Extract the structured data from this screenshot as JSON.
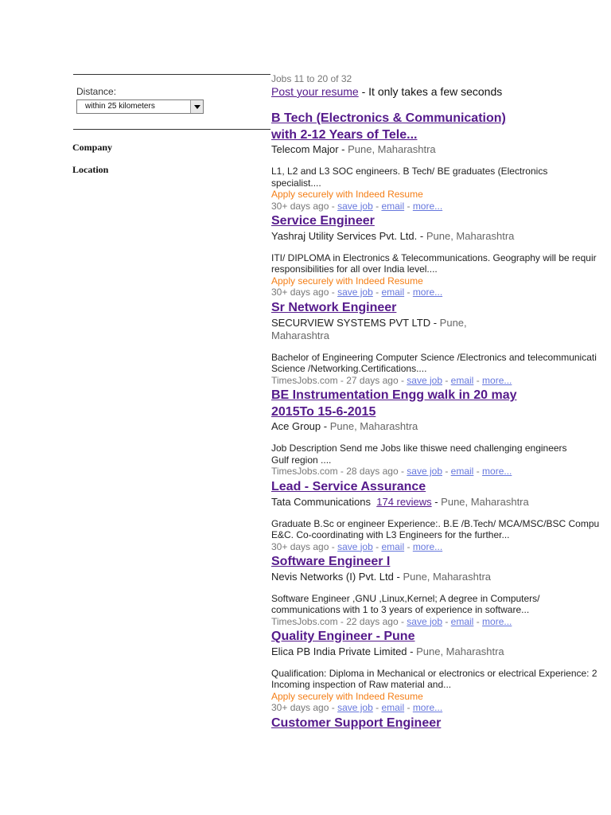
{
  "filters": {
    "distance_label": "Distance:",
    "distance_value": "within 25 kilometers",
    "company_label": "Company",
    "location_label": "Location"
  },
  "results": {
    "count_text": "Jobs 11 to 20 of 32",
    "post_resume_link": "Post your resume",
    "post_resume_suffix": " - It only takes a few seconds"
  },
  "separator": " - ",
  "jobs": [
    {
      "title_line1": "B Tech (Electronics & Communication)",
      "title_line2": "with 2-12 Years of Tele...",
      "company": "Telecom Major",
      "location": "Pune, Maharashtra",
      "snippet_line1": "L1, L2 and L3 SOC engineers. B Tech/ BE graduates (Electronics",
      "snippet_line2": "specialist....",
      "apply": "Apply securely with Indeed Resume",
      "source": "30+ days ago",
      "save": "save job",
      "email": "email",
      "more": "more..."
    },
    {
      "title": "Service Engineer",
      "company": "Yashraj Utility Services Pvt. Ltd.",
      "location": "Pune, Maharashtra",
      "snippet_line1": "ITI/ DIPLOMA in Electronics & Telecommunications. Geography will be requir",
      "snippet_line2": "responsibilities for all over India level....",
      "apply": "Apply securely with Indeed Resume",
      "source": "30+ days ago",
      "save": "save job",
      "email": "email",
      "more": "more..."
    },
    {
      "title": "Sr Network Engineer",
      "company": "SECURVIEW SYSTEMS PVT LTD",
      "location_line1": "Pune,",
      "location_line2": "Maharashtra",
      "snippet_line1": "Bachelor of Engineering Computer Science /Electronics and telecommunicati",
      "snippet_line2": "Science /Networking.Certifications....",
      "source": "TimesJobs.com - 27 days ago",
      "save": "save job",
      "email": "email",
      "more": "more..."
    },
    {
      "title_line1": "BE Instrumentation Engg walk in 20 may",
      "title_line2": "2015To 15-6-2015",
      "company": "Ace Group",
      "location": "Pune, Maharashtra",
      "snippet_line1": "Job Description Send me Jobs like thiswe need challenging engineers",
      "snippet_line2": "Gulf region ....",
      "source": "TimesJobs.com - 28 days ago",
      "save": "save job",
      "email": "email",
      "more": "more..."
    },
    {
      "title": "Lead - Service Assurance",
      "company": "Tata Communications",
      "reviews": "174 reviews",
      "location": "Pune, Maharashtra",
      "snippet_line1": "Graduate B.Sc or engineer Experience:. B.E /B.Tech/ MCA/MSC/BSC Compu",
      "snippet_line2": "E&C. Co-coordinating with L3 Engineers for the further...",
      "source": "30+ days ago",
      "save": "save job",
      "email": "email",
      "more": "more..."
    },
    {
      "title": "Software Engineer I",
      "company": "Nevis Networks (I) Pvt. Ltd",
      "location": "Pune, Maharashtra",
      "snippet_line1": "Software Engineer ,GNU ,Linux,Kernel; A degree in Computers/",
      "snippet_line2": "communications with 1 to 3 years of experience in software...",
      "source": "TimesJobs.com - 22 days ago",
      "save": "save job",
      "email": "email",
      "more": "more..."
    },
    {
      "title": "Quality Engineer - Pune",
      "company": "Elica PB India Private Limited",
      "location": "Pune, Maharashtra",
      "snippet_line1": "Qualification: Diploma in Mechanical or electronics or electrical Experience: 2",
      "snippet_line2": "Incoming inspection of Raw material and...",
      "apply": "Apply securely with Indeed Resume",
      "source": "30+ days ago",
      "save": "save job",
      "email": "email",
      "more": "more..."
    },
    {
      "title": "Customer Support Engineer"
    }
  ]
}
